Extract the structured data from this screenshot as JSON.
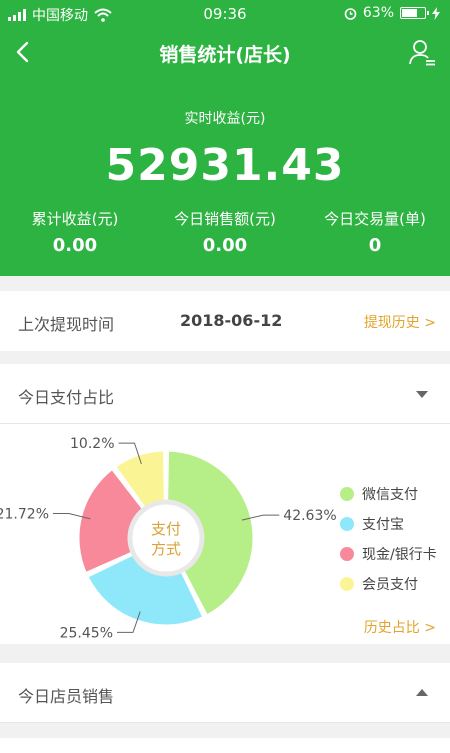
{
  "status_bar": {
    "carrier": "中国移动",
    "time": "09:36",
    "battery": "63%"
  },
  "nav": {
    "title": "销售统计(店长)"
  },
  "summary": {
    "realtime_label": "实时收益(元)",
    "realtime_value": "52931.43",
    "stats": [
      {
        "label": "累计收益(元)",
        "value": "0.00"
      },
      {
        "label": "今日销售额(元)",
        "value": "0.00"
      },
      {
        "label": "今日交易量(单)",
        "value": "0"
      }
    ]
  },
  "withdraw": {
    "label": "上次提现时间",
    "date": "2018-06-12",
    "link": "提现历史 >"
  },
  "payment": {
    "title": "今日支付占比",
    "center_line1": "支付",
    "center_line2": "方式",
    "history_link": "历史占比 >",
    "legend": [
      {
        "label": "微信支付",
        "color": "#b6ef88"
      },
      {
        "label": "支付宝",
        "color": "#8ee8fa"
      },
      {
        "label": "现金/银行卡",
        "color": "#f7899a"
      },
      {
        "label": "会员支付",
        "color": "#fbf494"
      }
    ]
  },
  "chart_data": {
    "type": "pie",
    "categories": [
      "微信支付",
      "支付宝",
      "现金/银行卡",
      "会员支付"
    ],
    "values": [
      42.63,
      25.45,
      21.72,
      10.2
    ],
    "labels": [
      "42.63%",
      "25.45%",
      "21.72%",
      "10.2%"
    ],
    "colors": [
      "#b6ef88",
      "#8ee8fa",
      "#f7899a",
      "#fbf494"
    ],
    "legend": "right"
  },
  "staff": {
    "title": "今日店员销售"
  }
}
